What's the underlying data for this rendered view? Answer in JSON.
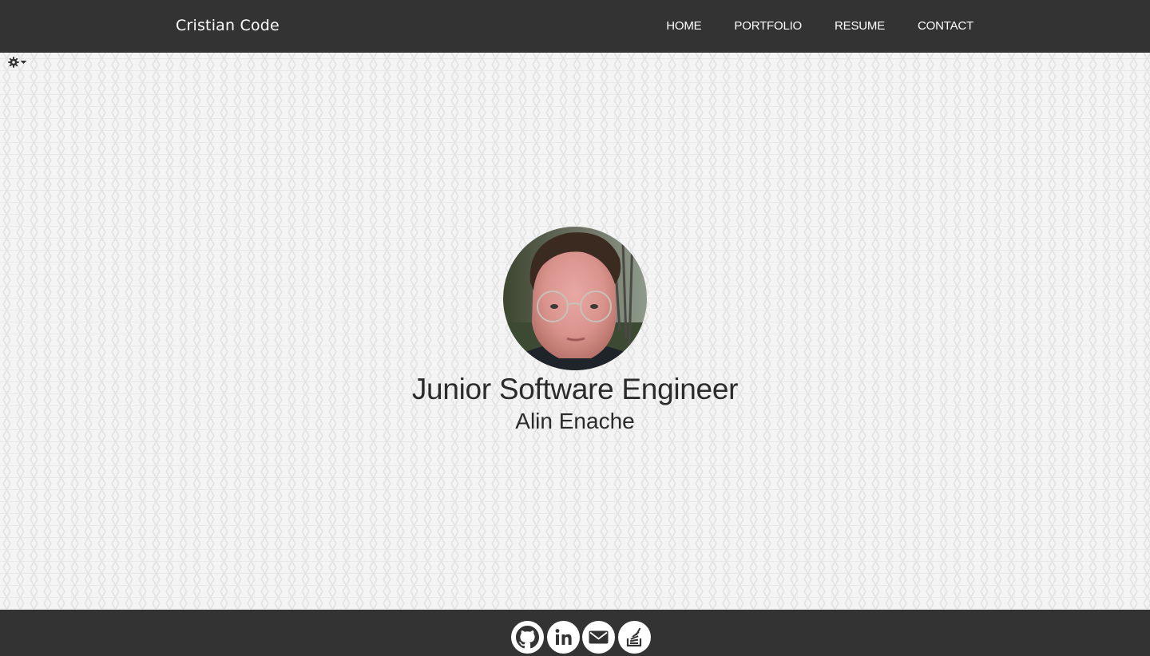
{
  "navbar": {
    "brand": "Cristian Code",
    "links": [
      {
        "label": "HOME"
      },
      {
        "label": "PORTFOLIO"
      },
      {
        "label": "RESUME"
      },
      {
        "label": "CONTACT"
      }
    ]
  },
  "settings": {
    "icon": "gear-icon"
  },
  "hero": {
    "avatar_icon": "profile-photo",
    "title": "Junior Software Engineer",
    "name": "Alin Enache"
  },
  "footer": {
    "social": [
      {
        "icon": "github-icon"
      },
      {
        "icon": "linkedin-icon"
      },
      {
        "icon": "email-icon"
      },
      {
        "icon": "stackoverflow-icon"
      }
    ]
  },
  "colors": {
    "navbar_bg": "#333333",
    "footer_bg": "#333333",
    "text_dark": "#2b2b2b",
    "nav_text": "#ffffff"
  }
}
